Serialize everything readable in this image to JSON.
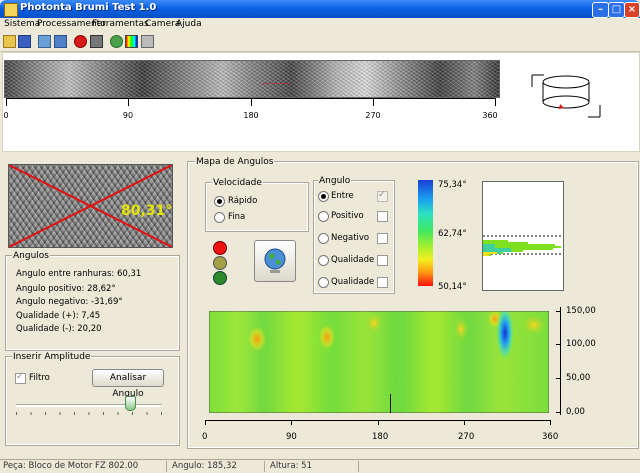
{
  "window": {
    "title": "Photonta Brumi Test 1.0"
  },
  "menu": [
    "Sistema",
    "Processamento",
    "Ferramentas",
    "Camera",
    "Ajuda"
  ],
  "toolbar_icons": [
    "open-folder-icon",
    "save-icon",
    "copy-icon",
    "paste-icon",
    "record-icon",
    "camera-icon",
    "map-icon",
    "color-palette-icon",
    "print-icon"
  ],
  "strip_axis": {
    "ticks": [
      "0",
      "90",
      "180",
      "270",
      "360"
    ]
  },
  "angle_image": {
    "overlay": "80,31°"
  },
  "angulos": {
    "title": "Angulos",
    "rows": [
      "Angulo entre ranhuras: 60,31",
      "Angulo positivo: 28,62°",
      "Angulo negativo: -31,69°",
      "Qualidade (+): 7,45",
      "Qualidade (-): 20,20"
    ]
  },
  "inserir": {
    "title": "Inserir Amplitude",
    "filtro_label": "Filtro",
    "filtro_checked": true,
    "button": "Analisar Angulo",
    "slider_value": 0.7
  },
  "mapa": {
    "title": "Mapa de Angulos",
    "velocidade": {
      "title": "Velocidade",
      "options": [
        "Rápido",
        "Fina"
      ],
      "selected": 0
    },
    "angulo": {
      "title": "Angulo",
      "options": [
        "Entre",
        "Positivo",
        "Negativo",
        "Qualidade +",
        "Qualidade -"
      ],
      "selected": 0
    },
    "lights": [
      "#ee1111",
      "#a3a047",
      "#2a8a2a"
    ],
    "colorbar": {
      "top": "75,34°",
      "mid": "62,74°",
      "bottom": "50,14°"
    },
    "heatmap_x_ticks": [
      "0",
      "90",
      "180",
      "270",
      "360"
    ],
    "heatmap_y_ticks": [
      "150,00",
      "100,00",
      "50,00",
      "0,00"
    ]
  },
  "status": {
    "left": "Peça: Bloco de Motor FZ 802.00",
    "mid": "Angulo: 185,32",
    "right": "Altura: 51"
  }
}
